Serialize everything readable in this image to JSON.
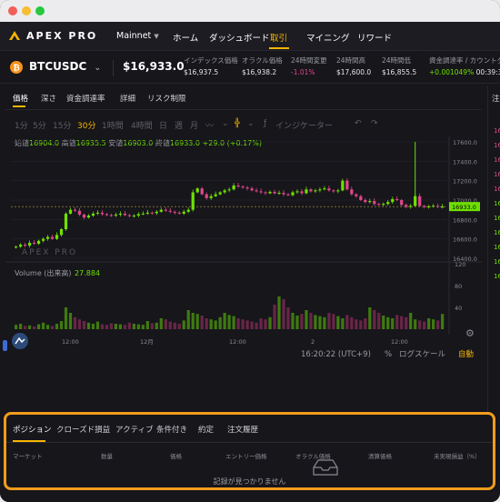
{
  "nav": {
    "brand": "APEX PRO",
    "network": "Mainnet",
    "items": [
      "ホーム",
      "ダッシュボード",
      "取引",
      "マイニング",
      "リワード"
    ],
    "active": "取引"
  },
  "ticker": {
    "pair": "BTCUSDC",
    "price": "$16,933.0",
    "stats": [
      {
        "label": "インデックス価格",
        "value": "$16,937.5"
      },
      {
        "label": "オラクル価格",
        "value": "$16,938.2"
      },
      {
        "label": "24時間変更",
        "value": "-1.01%"
      },
      {
        "label": "24時間高",
        "value": "$17,600.0"
      },
      {
        "label": "24時間低",
        "value": "$16,855.5"
      },
      {
        "label": "資金調達率 / カウントダウ",
        "value": "+0.001049%",
        "value2": "00:39:37"
      }
    ]
  },
  "chart_tabs": [
    "価格",
    "深さ",
    "資金調達率",
    "詳細",
    "リスク制限"
  ],
  "toolbar": {
    "intervals": [
      "1分",
      "5分",
      "15分",
      "30分",
      "1時間",
      "4時間",
      "日",
      "週",
      "月"
    ],
    "active_interval": "30分",
    "indicator": "インジケーター"
  },
  "ohlc": {
    "open_label": "始値",
    "open": "16904.0",
    "high_label": "高値",
    "high": "16935.5",
    "low_label": "安値",
    "low": "16903.0",
    "close_label": "終値",
    "close": "16933.0",
    "change": "+29.0 (+0.17%)"
  },
  "chart_data": {
    "type": "candlestick",
    "price_ticks": [
      17600.0,
      17400.0,
      17200.0,
      17000.0,
      16800.0,
      16600.0,
      16400.0
    ],
    "price_range": [
      16400,
      17600
    ],
    "last_price": 16933.0,
    "volume_label": "Volume (出来高)",
    "volume_value": "27.884",
    "volume_ticks": [
      120,
      80,
      40
    ],
    "volume_range": [
      0,
      120
    ],
    "time_ticks": [
      "12:00",
      "12月",
      "12:00",
      "2",
      "12:00"
    ],
    "up_color": "#6fe000",
    "down_color": "#e0478a",
    "closes": [
      16520,
      16540,
      16530,
      16560,
      16550,
      16580,
      16600,
      16620,
      16600,
      16640,
      16700,
      16860,
      16900,
      16890,
      16850,
      16820,
      16840,
      16860,
      16870,
      16855,
      16845,
      16840,
      16850,
      16860,
      16845,
      16835,
      16840,
      16855,
      16860,
      16870,
      16865,
      16880,
      16900,
      16890,
      16880,
      16870,
      16860,
      16880,
      16900,
      17080,
      17120,
      17060,
      17020,
      17040,
      17060,
      17080,
      17100,
      17110,
      17150,
      17140,
      17130,
      17120,
      17100,
      17090,
      17080,
      17070,
      17085,
      17070,
      17075,
      17060,
      17050,
      17080,
      17090,
      17070,
      17110,
      17090,
      17100,
      17110,
      17120,
      17100,
      17090,
      17100,
      17200,
      17110,
      17060,
      17040,
      17000,
      16980,
      16990,
      16960,
      16950,
      16960,
      16980,
      17010,
      17000,
      16950,
      16930,
      16940,
      17040,
      16940,
      16930,
      16935,
      16940,
      16930,
      16933
    ],
    "volumes": [
      8,
      10,
      6,
      7,
      5,
      9,
      12,
      8,
      6,
      10,
      15,
      40,
      30,
      22,
      18,
      15,
      12,
      10,
      14,
      9,
      8,
      11,
      10,
      9,
      8,
      12,
      10,
      9,
      8,
      15,
      11,
      12,
      20,
      18,
      14,
      12,
      10,
      16,
      35,
      30,
      28,
      25,
      20,
      18,
      16,
      22,
      30,
      26,
      24,
      20,
      18,
      16,
      14,
      12,
      20,
      18,
      22,
      45,
      60,
      55,
      40,
      30,
      25,
      28,
      35,
      30,
      26,
      24,
      22,
      30,
      28,
      24,
      20,
      26,
      22,
      18,
      16,
      20,
      40,
      35,
      30,
      25,
      22,
      20,
      26,
      24,
      22,
      30,
      18,
      16,
      14,
      20,
      18,
      16,
      28
    ]
  },
  "chart_footer": {
    "time": "16:20:22 (UTC+9)",
    "percent": "%",
    "log": "ログスケール",
    "auto": "自動"
  },
  "bottom": {
    "tabs": [
      "ポジション",
      "クローズド損益",
      "アクティブ",
      "条件付き",
      "約定",
      "注文履歴"
    ],
    "active": "ポジション",
    "columns": [
      "マーケット",
      "数量",
      "価格",
      "エントリー価格",
      "オラクル価格",
      "清算価格",
      "未実現損益（%）"
    ],
    "empty": "記録が見つかりません"
  },
  "side_prices": [
    "16",
    "16",
    "16",
    "16",
    "16",
    "16",
    "16",
    "16",
    "16",
    "16",
    "16"
  ],
  "side_label": "注"
}
